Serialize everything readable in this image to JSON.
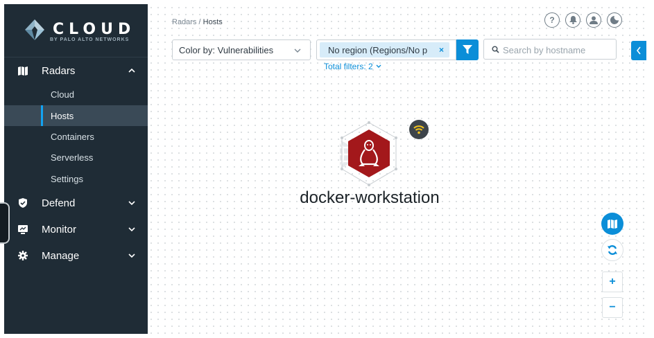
{
  "brand": {
    "name": "CLOUD",
    "subtitle": "BY PALO ALTO NETWORKS"
  },
  "sidebar": {
    "sections": [
      {
        "label": "Radars",
        "icon": "radar-icon",
        "expanded": true,
        "items": [
          {
            "label": "Cloud",
            "active": false
          },
          {
            "label": "Hosts",
            "active": true
          },
          {
            "label": "Containers",
            "active": false
          },
          {
            "label": "Serverless",
            "active": false
          },
          {
            "label": "Settings",
            "active": false
          }
        ]
      },
      {
        "label": "Defend",
        "icon": "shield-icon",
        "expanded": false
      },
      {
        "label": "Monitor",
        "icon": "monitor-icon",
        "expanded": false
      },
      {
        "label": "Manage",
        "icon": "gear-icon",
        "expanded": false
      }
    ]
  },
  "breadcrumb": {
    "parent": "Radars",
    "separator": " / ",
    "current": "Hosts"
  },
  "header_icons": [
    "help-icon",
    "notifications-icon",
    "user-icon",
    "theme-icon"
  ],
  "toolbar": {
    "color_by_label": "Color by: Vulnerabilities",
    "filter_chip_label": "No region (Regions/No p",
    "filter_chip_remove": "×",
    "total_filters_label": "Total filters: 2",
    "search_placeholder": "Search by hostname"
  },
  "radar": {
    "node_label": "docker-workstation",
    "node_os_icon": "linux-icon",
    "node_color": "#a3181b",
    "badge_icon": "wifi-icon",
    "side_icon": "globe-icon"
  },
  "controls": {
    "zoom_in": "+",
    "zoom_out": "−"
  },
  "colors": {
    "accent": "#0b8ed8",
    "sidebar_bg": "#1f2c36",
    "node_red": "#a3181b"
  }
}
